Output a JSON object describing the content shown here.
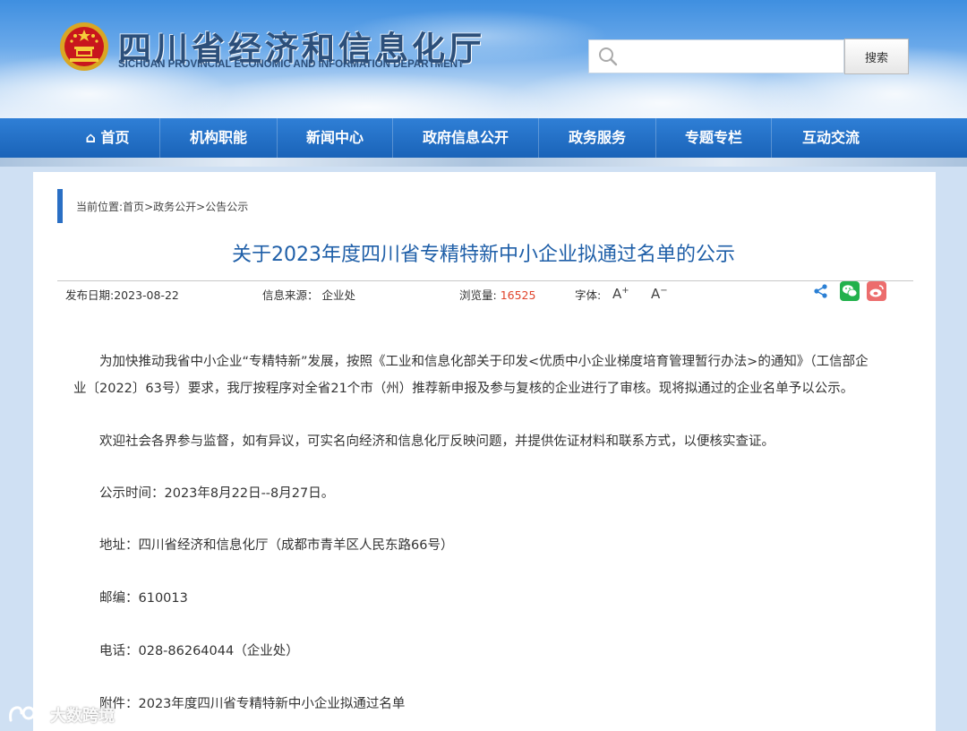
{
  "header": {
    "title_cn": "四川省经济和信息化厅",
    "title_en": "SICHUAN PROVINCIAL ECONOMIC AND INFORMATION DEPARTMENT",
    "search": {
      "placeholder": "",
      "button_label": "搜索"
    }
  },
  "nav": {
    "items": [
      {
        "label": "⌂ 首页"
      },
      {
        "label": "机构职能"
      },
      {
        "label": "新闻中心"
      },
      {
        "label": "政府信息公开"
      },
      {
        "label": "政务服务"
      },
      {
        "label": "专题专栏"
      },
      {
        "label": "互动交流"
      }
    ]
  },
  "breadcrumb": {
    "prefix": "当前位置: ",
    "home": "首页",
    "sep1": ">",
    "item1": "政务公开",
    "sep2": ">",
    "item2": "公告公示"
  },
  "article": {
    "title": "关于2023年度四川省专精特新中小企业拟通过名单的公示",
    "publish_date": "发布日期:2023-08-22",
    "source": "信息来源： 企业处",
    "views_label": "浏览量: ",
    "views": "16525",
    "font_label": "字体:",
    "font_increase": "A",
    "font_decrease": "A",
    "paragraphs": {
      "p1_line1": "为加快推动我省中小企业“专精特新”发展，按照《工业和信息化部关于印发<优质中小企业梯度培育管理暂行办法>的通知》（工信部企",
      "p1_line2": "业〔2022〕63号）要求，我厅按程序对全省21个市（州）推荐新申报及参与复核的企业进行了审核。现将拟通过的企业名单予以公示。",
      "p2": "欢迎社会各界参与监督，如有异议，可实名向经济和信息化厅反映问题，并提供佐证材料和联系方式，以便核实查证。",
      "p3": "公示时间：2023年8月22日--8月27日。",
      "p4": "地址：四川省经济和信息化厅（成都市青羊区人民东路66号）",
      "p5": "邮编：610013",
      "p6": "电话：028-86264044（企业处）",
      "p7": "附件：2023年度四川省专精特新中小企业拟通过名单"
    }
  },
  "share": {
    "icons": [
      "share-icon",
      "wechat-icon",
      "weibo-icon"
    ]
  },
  "watermark": {
    "text": "大数跨境"
  },
  "colors": {
    "nav": "#1a63b8",
    "title": "#1f5fa8",
    "views": "#e0432b",
    "accent_bar": "#2a6fc4"
  }
}
